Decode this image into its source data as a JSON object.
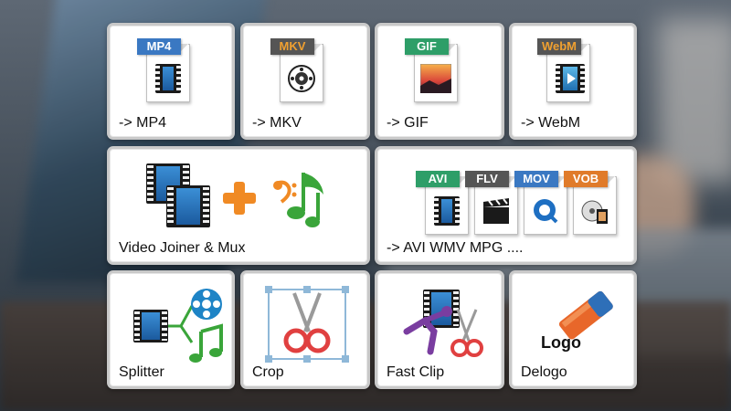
{
  "tiles": {
    "mp4": {
      "label": "-> MP4",
      "badge": "MP4",
      "badge_color": "#3a78c2",
      "icon": "film-icon"
    },
    "mkv": {
      "label": "-> MKV",
      "badge": "MKV",
      "badge_color": "#555555",
      "icon": "disc-icon"
    },
    "gif": {
      "label": "-> GIF",
      "badge": "GIF",
      "badge_color": "#2e9e68",
      "icon": "sunset-image-icon"
    },
    "webm": {
      "label": "-> WebM",
      "badge": "WebM",
      "badge_color": "#555555",
      "icon": "film-play-icon"
    },
    "joiner": {
      "label": "Video Joiner & Mux",
      "icon": "film-plus-music-icon"
    },
    "formats": {
      "label": "-> AVI WMV MPG ....",
      "badges": [
        {
          "text": "AVI",
          "color": "#2e9e68"
        },
        {
          "text": "FLV",
          "color": "#555555"
        },
        {
          "text": "MOV",
          "color": "#3a78c2"
        },
        {
          "text": "VOB",
          "color": "#e07b2a"
        }
      ]
    },
    "splitter": {
      "label": "Splitter",
      "icon": "split-icon"
    },
    "crop": {
      "label": "Crop",
      "icon": "scissors-crop-icon"
    },
    "fastclip": {
      "label": "Fast Clip",
      "icon": "fast-clip-icon"
    },
    "delogo": {
      "label": "Delogo",
      "logo_text": "Logo",
      "icon": "eraser-icon"
    }
  }
}
